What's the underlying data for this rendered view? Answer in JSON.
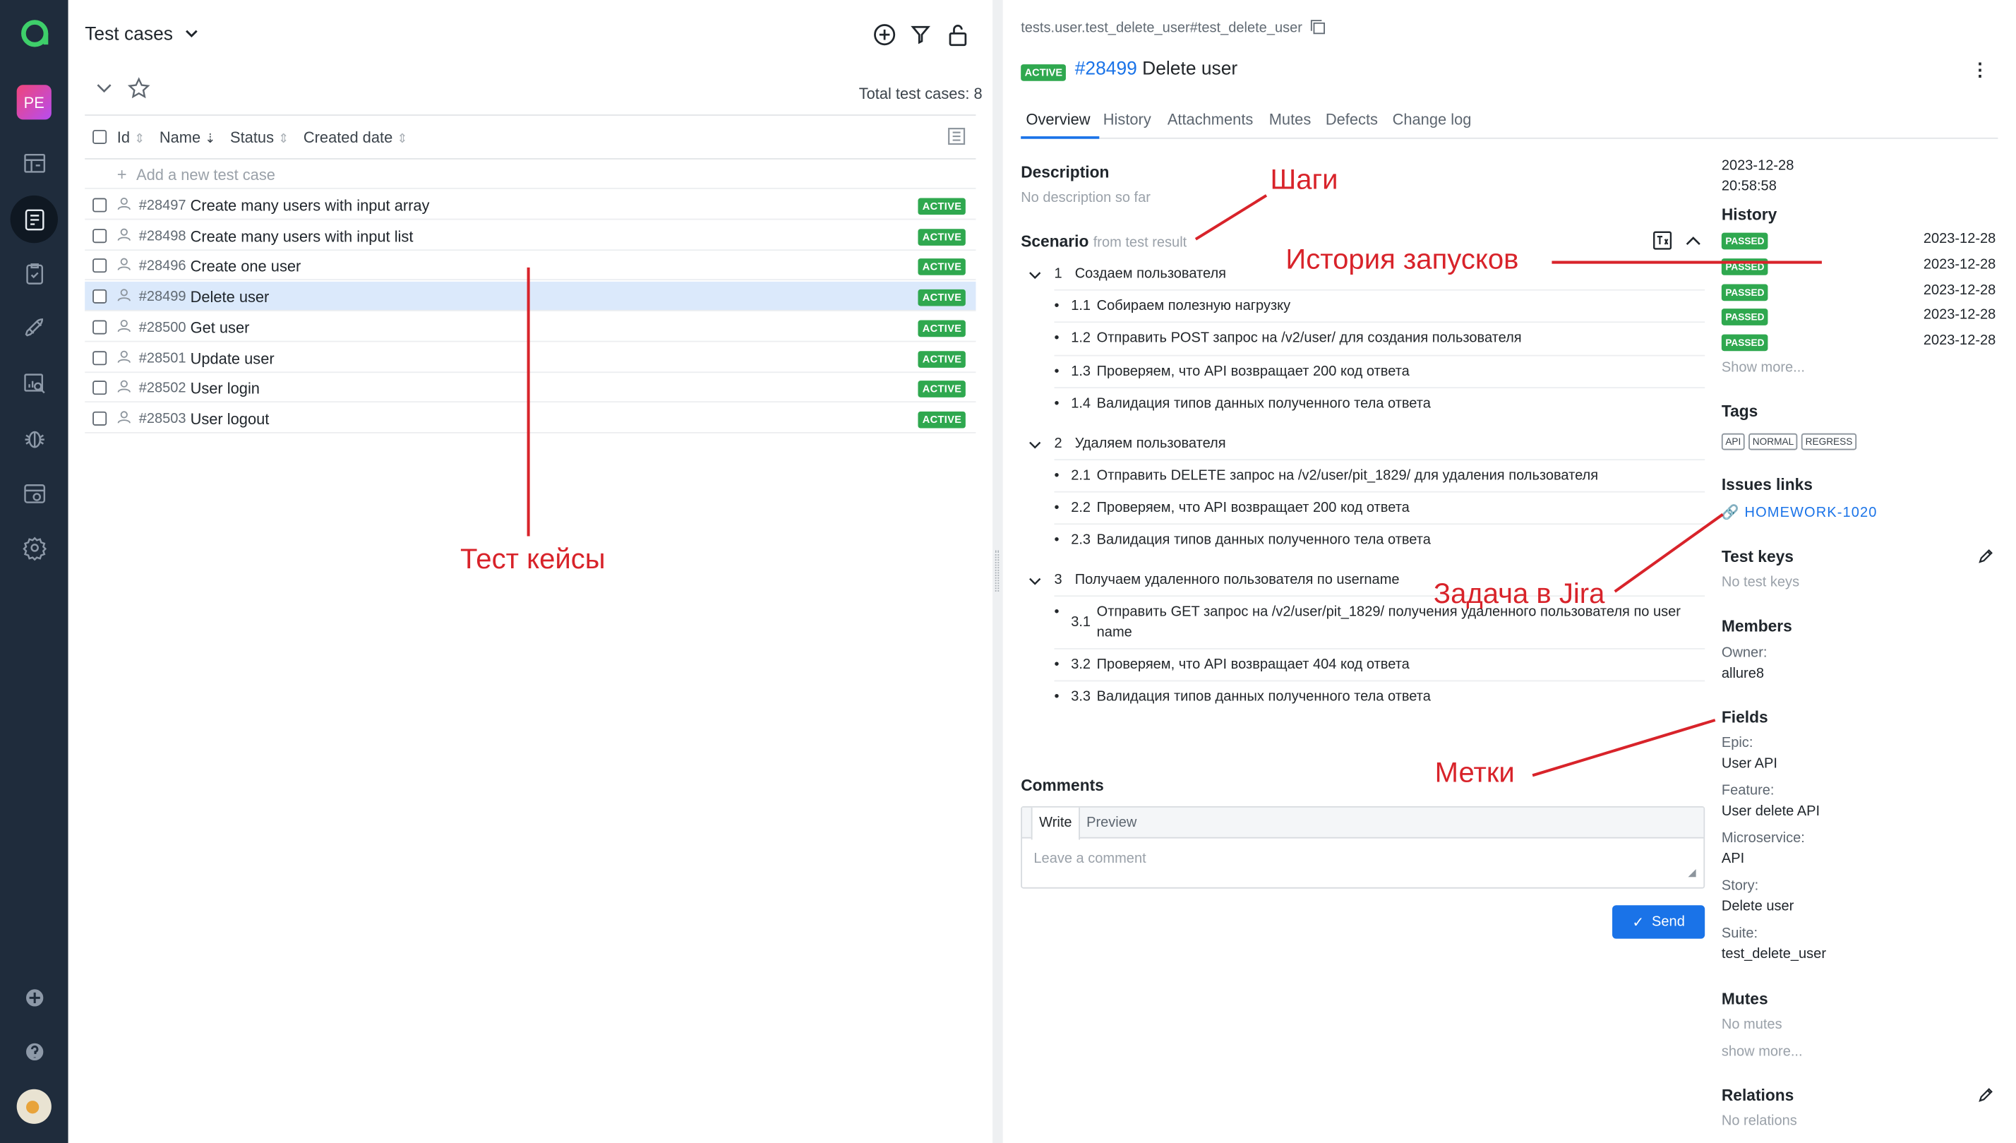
{
  "sidebar": {
    "profile_initials": "PE"
  },
  "left": {
    "title": "Test cases",
    "total": "Total test cases: 8",
    "columns": {
      "id": "Id",
      "name": "Name",
      "status": "Status",
      "created": "Created date"
    },
    "add_new": "Add a new test case",
    "rows": [
      {
        "id": "#28497",
        "name": "Create many users with input array",
        "status": "ACTIVE"
      },
      {
        "id": "#28498",
        "name": "Create many users with input list",
        "status": "ACTIVE"
      },
      {
        "id": "#28496",
        "name": "Create one user",
        "status": "ACTIVE"
      },
      {
        "id": "#28499",
        "name": "Delete user",
        "status": "ACTIVE"
      },
      {
        "id": "#28500",
        "name": "Get user",
        "status": "ACTIVE"
      },
      {
        "id": "#28501",
        "name": "Update user",
        "status": "ACTIVE"
      },
      {
        "id": "#28502",
        "name": "User login",
        "status": "ACTIVE"
      },
      {
        "id": "#28503",
        "name": "User logout",
        "status": "ACTIVE"
      }
    ]
  },
  "detail": {
    "path": "tests.user.test_delete_user#test_delete_user",
    "status": "ACTIVE",
    "id": "#28499",
    "title": "Delete user",
    "tabs": [
      "Overview",
      "History",
      "Attachments",
      "Mutes",
      "Defects",
      "Change log"
    ],
    "description_label": "Description",
    "description_value": "No description so far",
    "scenario_label": "Scenario",
    "scenario_source": "from test result",
    "steps": [
      {
        "num": "1",
        "text": "Создаем пользователя",
        "sub": [
          {
            "num": "1.1",
            "text": "Собираем полезную нагрузку"
          },
          {
            "num": "1.2",
            "text": "Отправить POST запрос на /v2/user/ для создания пользователя"
          },
          {
            "num": "1.3",
            "text": "Проверяем, что API возвращает 200 код ответа"
          },
          {
            "num": "1.4",
            "text": "Валидация типов данных полученного тела ответа"
          }
        ]
      },
      {
        "num": "2",
        "text": "Удаляем пользователя",
        "sub": [
          {
            "num": "2.1",
            "text": "Отправить DELETE запрос на /v2/user/pit_1829/ для удаления пользователя"
          },
          {
            "num": "2.2",
            "text": "Проверяем, что API возвращает 200 код ответа"
          },
          {
            "num": "2.3",
            "text": "Валидация типов данных полученного тела ответа"
          }
        ]
      },
      {
        "num": "3",
        "text": "Получаем удаленного пользователя по username",
        "sub": [
          {
            "num": "3.1",
            "text": "Отправить GET запрос на /v2/user/pit_1829/ получения удаленного пользователя по user",
            "text2": "name"
          },
          {
            "num": "3.2",
            "text": "Проверяем, что API возвращает 404 код ответа"
          },
          {
            "num": "3.3",
            "text": "Валидация типов данных полученного тела ответа"
          }
        ]
      }
    ],
    "comments_label": "Comments",
    "write_tab": "Write",
    "preview_tab": "Preview",
    "comment_placeholder": "Leave a comment",
    "send_label": "Send"
  },
  "meta": {
    "date": "2023-12-28",
    "time": "20:58:58",
    "history_label": "History",
    "history": [
      {
        "status": "PASSED",
        "date": "2023-12-28"
      },
      {
        "status": "PASSED",
        "date": "2023-12-28"
      },
      {
        "status": "PASSED",
        "date": "2023-12-28"
      },
      {
        "status": "PASSED",
        "date": "2023-12-28"
      },
      {
        "status": "PASSED",
        "date": "2023-12-28"
      }
    ],
    "show_more": "Show more...",
    "tags_label": "Tags",
    "tags": [
      "API",
      "NORMAL",
      "REGRESS"
    ],
    "issues_label": "Issues links",
    "issue": "HOMEWORK-1020",
    "keys_label": "Test keys",
    "keys_value": "No test keys",
    "members_label": "Members",
    "owner_label": "Owner:",
    "owner_value": "allure8",
    "fields_label": "Fields",
    "fields": [
      {
        "label": "Epic:",
        "value": "User API"
      },
      {
        "label": "Feature:",
        "value": "User delete API"
      },
      {
        "label": "Microservice:",
        "value": "API"
      },
      {
        "label": "Story:",
        "value": "Delete user"
      },
      {
        "label": "Suite:",
        "value": "test_delete_user"
      }
    ],
    "mutes_label": "Mutes",
    "mutes_value": "No mutes",
    "mutes_more": "show more...",
    "relations_label": "Relations",
    "relations_value": "No relations"
  },
  "annotations": {
    "steps": "Шаги",
    "history": "История запусков",
    "testcases": "Тест кейсы",
    "jira": "Задача в Jira",
    "labels": "Метки"
  },
  "colors": {
    "sidebar": "#1f2c3c",
    "accent": "#1a73e8",
    "passed": "#2fa84f",
    "annotation": "#d8232a"
  }
}
